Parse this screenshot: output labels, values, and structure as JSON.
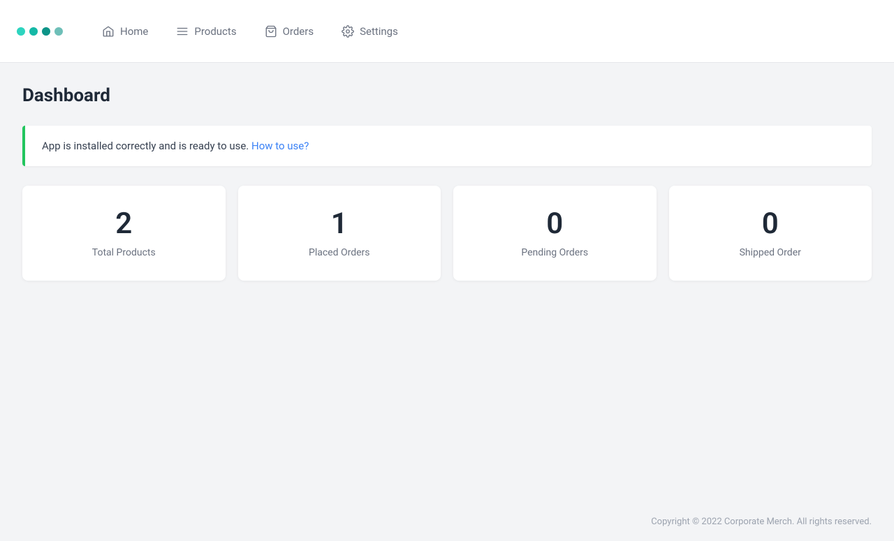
{
  "header": {
    "nav_items": [
      {
        "id": "home",
        "label": "Home",
        "icon": "home-icon"
      },
      {
        "id": "products",
        "label": "Products",
        "icon": "list-icon"
      },
      {
        "id": "orders",
        "label": "Orders",
        "icon": "cart-icon"
      },
      {
        "id": "settings",
        "label": "Settings",
        "icon": "gear-icon"
      }
    ]
  },
  "main": {
    "page_title": "Dashboard",
    "alert": {
      "message": "App is installed correctly and is ready to use.",
      "link_text": "How to use?",
      "link_href": "#"
    },
    "stats": [
      {
        "id": "total-products",
        "value": "2",
        "label": "Total Products"
      },
      {
        "id": "placed-orders",
        "value": "1",
        "label": "Placed Orders"
      },
      {
        "id": "pending-orders",
        "value": "0",
        "label": "Pending Orders"
      },
      {
        "id": "shipped-order",
        "value": "0",
        "label": "Shipped Order"
      }
    ]
  },
  "footer": {
    "copyright": "Copyright © 2022 Corporate Merch. All rights reserved."
  }
}
